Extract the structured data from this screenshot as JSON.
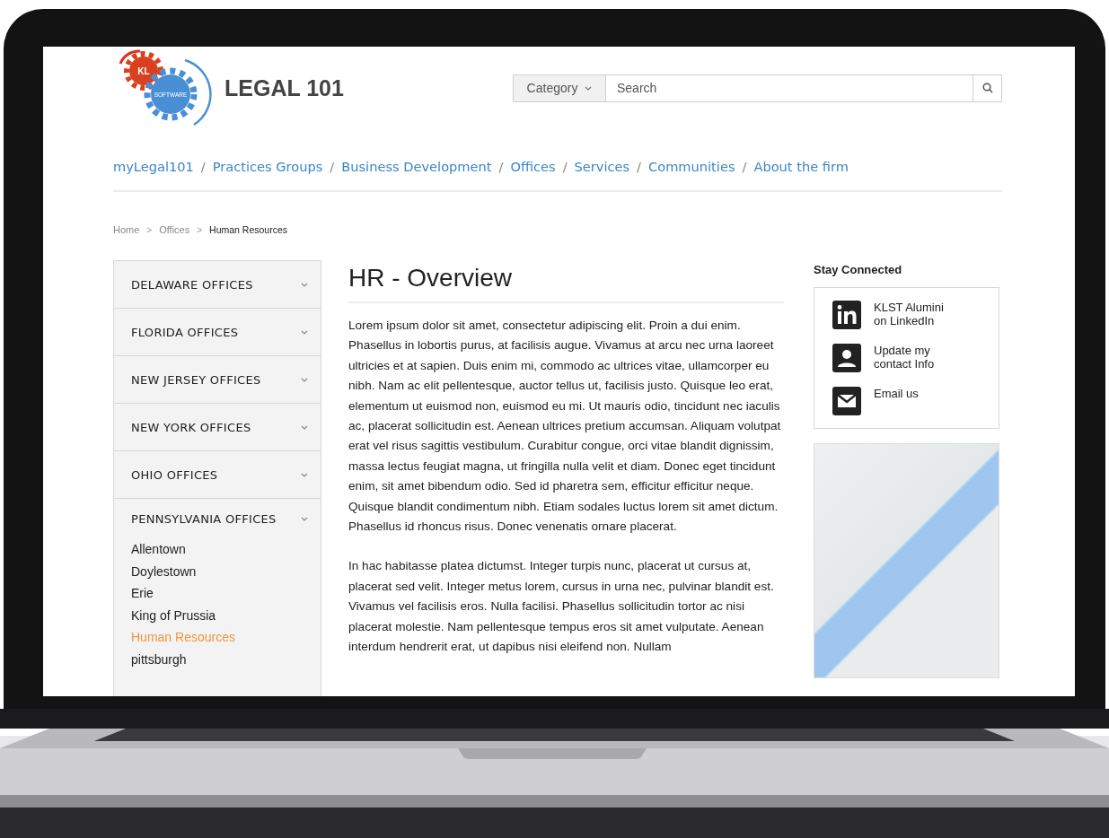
{
  "logo": {
    "badge_top": "KL",
    "badge_bottom": "SOFTWARE",
    "title": "LEGAL 101"
  },
  "search": {
    "category": "Category",
    "placeholder": "Search"
  },
  "nav": {
    "separator": "/",
    "items": [
      {
        "label": "myLegal101"
      },
      {
        "label": "Practices Groups"
      },
      {
        "label": "Business Development"
      },
      {
        "label": "Offices"
      },
      {
        "label": "Services"
      },
      {
        "label": "Communities"
      },
      {
        "label": "About the firm"
      }
    ]
  },
  "breadcrumb": {
    "separator": ">",
    "items": [
      {
        "label": "Home",
        "current": false
      },
      {
        "label": "Offices",
        "current": false
      },
      {
        "label": "Human Resources",
        "current": true
      }
    ]
  },
  "sidebar": [
    {
      "label": "DELAWARE OFFICES",
      "expanded": false
    },
    {
      "label": "FLORIDA OFFICES",
      "expanded": false
    },
    {
      "label": "NEW JERSEY OFFICES",
      "expanded": false
    },
    {
      "label": "NEW YORK OFFICES",
      "expanded": false
    },
    {
      "label": "OHIO OFFICES",
      "expanded": false
    },
    {
      "label": "PENNSYLVANIA OFFICES",
      "expanded": true,
      "children": [
        {
          "label": "Allentown",
          "selected": false
        },
        {
          "label": "Doylestown",
          "selected": false
        },
        {
          "label": "Erie",
          "selected": false
        },
        {
          "label": "King of Prussia",
          "selected": false
        },
        {
          "label": "Human Resources",
          "selected": true
        },
        {
          "label": "pittsburgh",
          "selected": false
        }
      ]
    }
  ],
  "article": {
    "title": "HR - Overview",
    "paragraphs": [
      "Lorem ipsum dolor sit amet, consectetur adipiscing elit. Proin a dui enim. Phasellus in lobortis purus, at facilisis augue. Vivamus at arcu nec urna laoreet ultricies et at sapien. Duis enim mi, commodo ac ultrices vitae, ullamcorper eu nibh. Nam ac elit pellentesque, auctor tellus ut, facilisis justo. Quisque leo erat, elementum ut euismod non, euismod eu mi. Ut mauris odio, tincidunt nec iaculis ac, placerat sollicitudin est. Aenean ultrices pretium accumsan. Aliquam volutpat erat vel risus sagittis vestibulum. Curabitur congue, orci vitae blandit dignissim, massa lectus feugiat magna, ut fringilla nulla velit et diam. Donec eget tincidunt enim, sit amet bibendum odio. Sed id pharetra sem, efficitur efficitur neque. Quisque blandit condimentum nibh. Etiam sodales luctus lorem sit amet dictum. Phasellus id rhoncus risus. Donec venenatis ornare placerat.",
      "In hac habitasse platea dictumst. Integer turpis nunc, placerat ut cursus at, placerat sed velit. Integer metus lorem, cursus in urna nec, pulvinar blandit est. Vivamus vel facilisis eros. Nulla facilisi. Phasellus sollicitudin tortor ac nisi placerat molestie. Nam pellentesque tempus eros sit amet vulputate. Aenean interdum hendrerit erat, ut dapibus nisi eleifend non. Nullam"
    ]
  },
  "stay_connected": {
    "heading": "Stay Connected",
    "items": [
      {
        "kind": "linkedin",
        "label": "KLST Alumini\non LinkedIn"
      },
      {
        "kind": "contact",
        "label": "Update my\ncontact Info"
      },
      {
        "kind": "email",
        "label": "Email us"
      }
    ]
  }
}
